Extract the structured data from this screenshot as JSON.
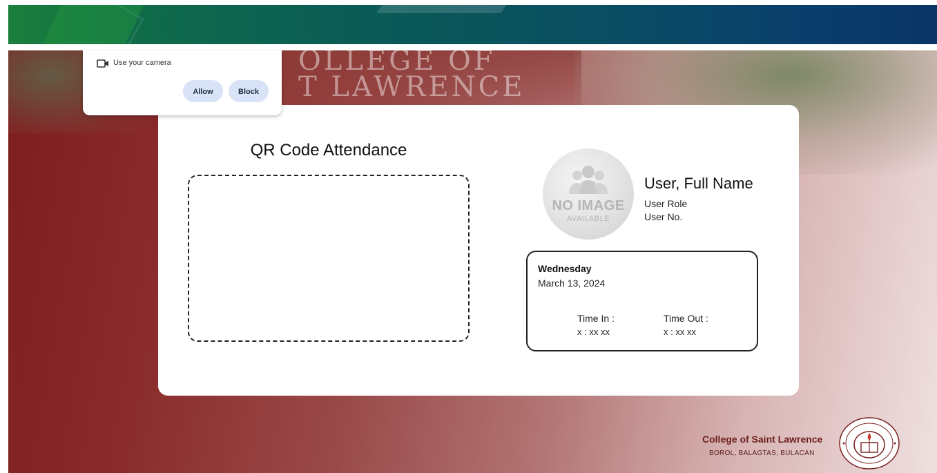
{
  "popup": {
    "camera_icon": "video-camera-icon",
    "prompt": "Use your camera",
    "allow_label": "Allow",
    "block_label": "Block"
  },
  "banner": {
    "building_text_line1": "OLLEGE OF",
    "building_text_line2": "T LAWRENCE"
  },
  "scanner": {
    "title": "QR Code Attendance"
  },
  "user": {
    "avatar_icon": "no-image-placeholder-icon",
    "avatar_main": "NO IMAGE",
    "avatar_sub": "AVAILABLE",
    "name": "User, Full Name",
    "role": "User Role",
    "number": "User No."
  },
  "attendance": {
    "day": "Wednesday",
    "date": "March 13, 2024",
    "time_in_label": "Time In :",
    "time_in_value": "x : xx xx",
    "time_out_label": "Time Out :",
    "time_out_value": "x : xx xx"
  },
  "footer": {
    "school_name": "College of Saint Lawrence",
    "address": "BOROL, BALAGTAS, BULACAN",
    "seal_icon": "school-seal-icon"
  },
  "colors": {
    "banner_green": "#1a7f3c",
    "banner_blue": "#0a3566",
    "background_maroon": "#7e1d1d",
    "button_bg": "#d8e3f7",
    "footer_text": "#6e1f1f"
  }
}
